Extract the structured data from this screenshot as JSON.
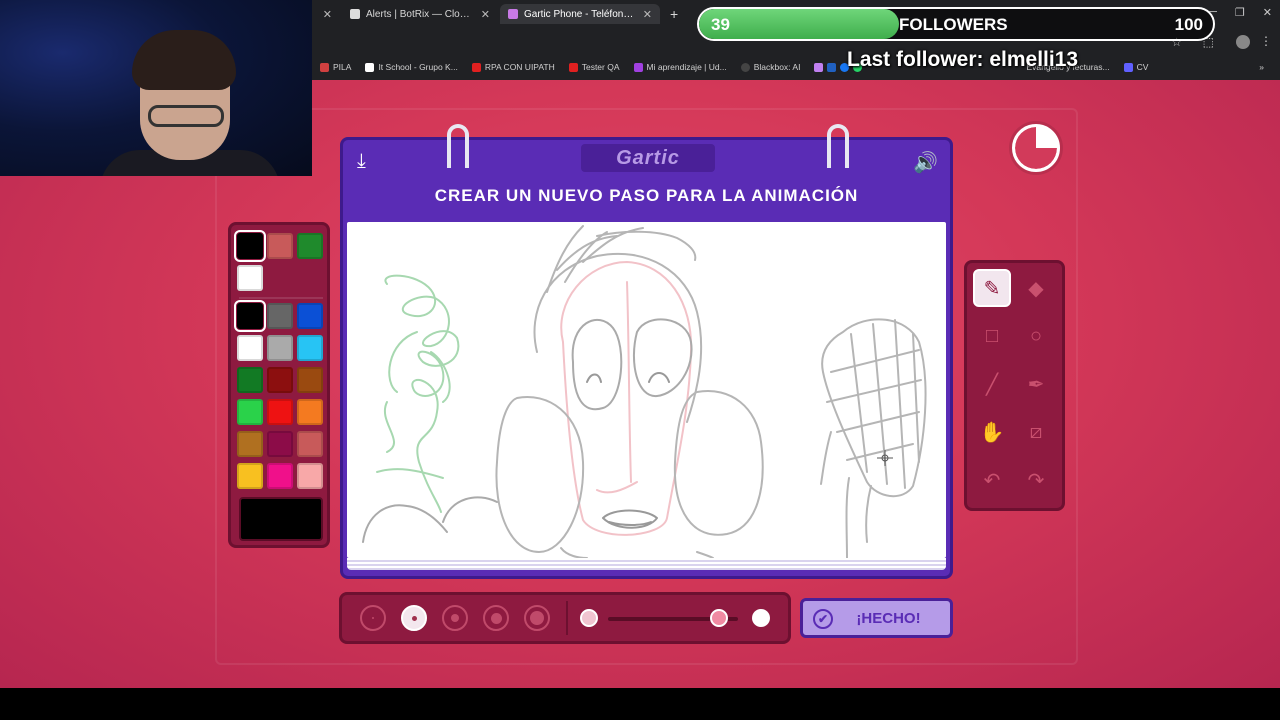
{
  "browser": {
    "tabs": [
      {
        "label": "Alerts | BotRix — Cloud Stream...",
        "active": false
      },
      {
        "label": "Gartic Phone - Teléfono Descon...",
        "active": true
      }
    ],
    "pinned_label": "",
    "new_tab": "+",
    "bookmarks": [
      {
        "label": "PILA"
      },
      {
        "label": "It School - Grupo K..."
      },
      {
        "label": "RPA CON UIPATH"
      },
      {
        "label": "Tester QA"
      },
      {
        "label": "Mi aprendizaje | Ud..."
      },
      {
        "label": "Blackbox: AI"
      },
      {
        "label": "Evangelio y lecturas..."
      },
      {
        "label": "CV"
      }
    ]
  },
  "overlay": {
    "followers_current": "39",
    "followers_label": "FOLLOWERS",
    "followers_goal": "100",
    "progress": 0.39,
    "last_follower": "Last follower: elmelli13"
  },
  "game": {
    "logo": "Gartic",
    "instruction": "CREAR UN NUEVO PASO PARA LA ANIMACIÓN",
    "done_label": "¡HECHO!",
    "timer_remaining_fraction": 0.75,
    "icons": {
      "download": "download-icon",
      "sound": "speaker-icon",
      "timer": "timer-icon"
    },
    "palette": {
      "recent": [
        "#000000",
        "#c85a5a",
        "#1f8a2c",
        "#ffffff"
      ],
      "colors": [
        "#000000",
        "#666666",
        "#0b50d6",
        "#ffffff",
        "#aaaaaa",
        "#27c4f4",
        "#127a24",
        "#8c0f0f",
        "#9a4a10",
        "#2ad24a",
        "#ee1212",
        "#f47a20",
        "#b07020",
        "#8c0c48",
        "#c85a5a",
        "#f8c020",
        "#f0108a",
        "#f8a8a8"
      ],
      "selected_color": "#000000"
    },
    "tools": [
      {
        "name": "pencil-icon",
        "selected": true
      },
      {
        "name": "eraser-icon",
        "selected": false
      },
      {
        "name": "rectangle-icon",
        "selected": false
      },
      {
        "name": "ellipse-icon",
        "selected": false
      },
      {
        "name": "line-icon",
        "selected": false
      },
      {
        "name": "eyedropper-icon",
        "selected": false
      },
      {
        "name": "fill-bucket-icon",
        "selected": false
      },
      {
        "name": "clear-layer-icon",
        "selected": false
      },
      {
        "name": "undo-icon",
        "selected": false
      },
      {
        "name": "redo-icon",
        "selected": false
      }
    ],
    "brush_sizes": [
      {
        "selected": false
      },
      {
        "selected": true
      },
      {
        "selected": false
      },
      {
        "selected": false
      },
      {
        "selected": false
      }
    ],
    "opacity_fraction": 0.85
  }
}
